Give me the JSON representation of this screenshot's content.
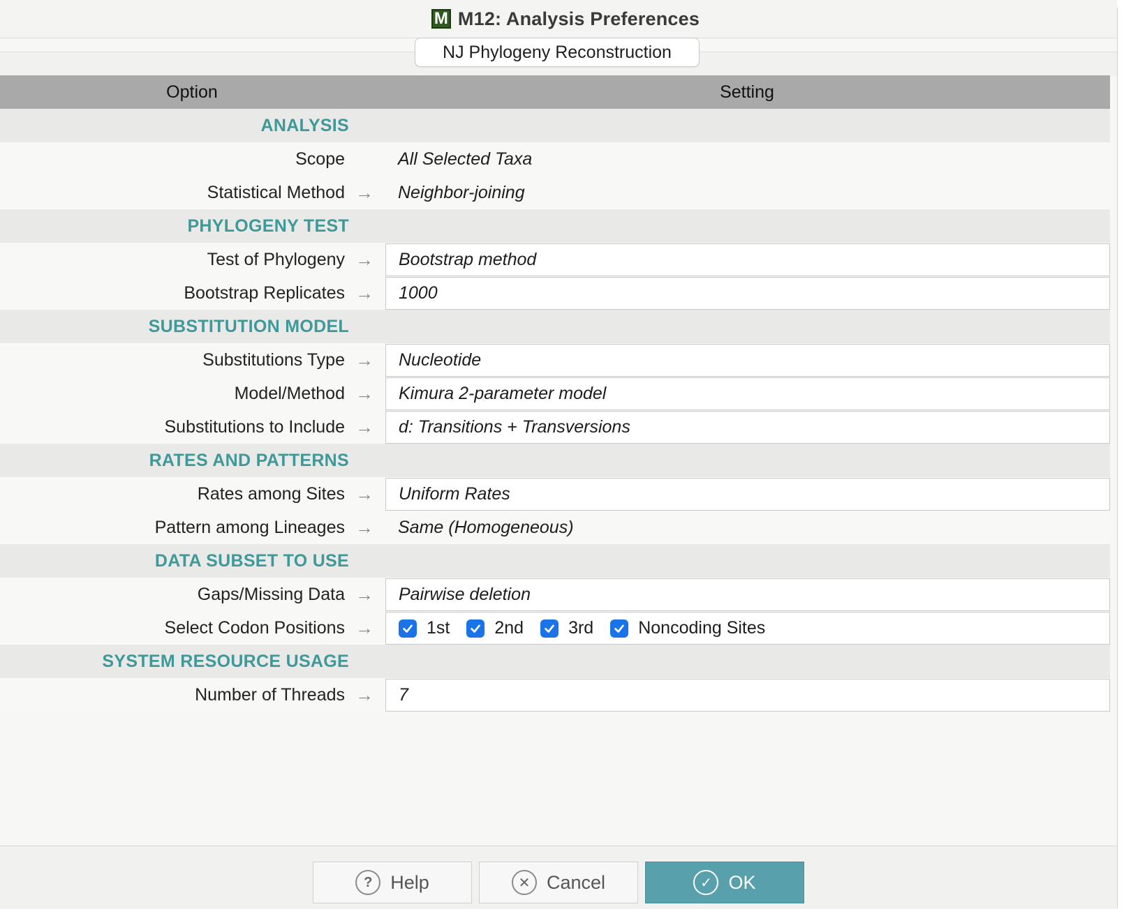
{
  "window": {
    "title": "M12: Analysis Preferences",
    "logo_letter": "M",
    "tab": "NJ Phylogeny Reconstruction"
  },
  "columns": {
    "option": "Option",
    "setting": "Setting"
  },
  "sections": {
    "analysis": {
      "title": "ANALYSIS",
      "scope": {
        "label": "Scope",
        "value": "All Selected Taxa"
      },
      "statistical_method": {
        "label": "Statistical Method",
        "value": "Neighbor-joining"
      }
    },
    "phylogeny_test": {
      "title": "PHYLOGENY TEST",
      "test_of_phylogeny": {
        "label": "Test of Phylogeny",
        "value": "Bootstrap method"
      },
      "bootstrap_replicates": {
        "label": "Bootstrap Replicates",
        "value": "1000"
      }
    },
    "substitution_model": {
      "title": "SUBSTITUTION MODEL",
      "substitutions_type": {
        "label": "Substitutions Type",
        "value": "Nucleotide"
      },
      "model_method": {
        "label": "Model/Method",
        "value": "Kimura 2-parameter model"
      },
      "substitutions_to_include": {
        "label": "Substitutions to Include",
        "value": "d: Transitions + Transversions"
      }
    },
    "rates_and_patterns": {
      "title": "RATES AND PATTERNS",
      "rates_among_sites": {
        "label": "Rates among Sites",
        "value": "Uniform Rates"
      },
      "pattern_among_lineages": {
        "label": "Pattern among Lineages",
        "value": "Same (Homogeneous)"
      }
    },
    "data_subset": {
      "title": "DATA SUBSET TO USE",
      "gaps_missing": {
        "label": "Gaps/Missing Data",
        "value": "Pairwise deletion"
      },
      "codon_positions": {
        "label": "Select Codon Positions",
        "options": [
          {
            "label": "1st",
            "checked": true
          },
          {
            "label": "2nd",
            "checked": true
          },
          {
            "label": "3rd",
            "checked": true
          },
          {
            "label": "Noncoding Sites",
            "checked": true
          }
        ]
      }
    },
    "system_resource": {
      "title": "SYSTEM RESOURCE USAGE",
      "threads": {
        "label": "Number of Threads",
        "value": "7"
      }
    }
  },
  "footer": {
    "help": "Help",
    "cancel": "Cancel",
    "ok": "OK"
  },
  "colors": {
    "section_title": "#3f9999",
    "header_bg": "#a9a9a9",
    "ok_button": "#57a0ac",
    "checkbox": "#1a73e8"
  },
  "icons": {
    "arrow": "right-arrow-icon",
    "help": "question-icon",
    "cancel": "x-circle-icon",
    "ok": "check-circle-icon"
  }
}
